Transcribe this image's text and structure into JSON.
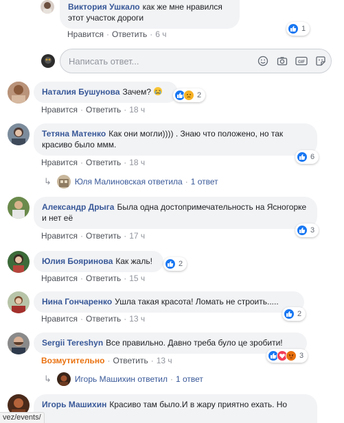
{
  "comments": [
    {
      "author": "Виктория Ушкало",
      "text": "как же мне нравился этот участок дороги",
      "like_label": "Нравится",
      "reply_label": "Ответить",
      "time": "6 ч",
      "reaction_count": "1"
    },
    {
      "author": "Наталия Бушунова",
      "text": "Зачем?",
      "like_label": "Нравится",
      "reply_label": "Ответить",
      "time": "18 ч",
      "reaction_count": "2"
    },
    {
      "author": "Тетяна Матенко",
      "text": "Как они могли)))) . Знаю что положено, но так красиво было ммм.",
      "like_label": "Нравится",
      "reply_label": "Ответить",
      "time": "18 ч",
      "reaction_count": "6"
    },
    {
      "author": "Александр Дрыга",
      "text": "Была одна достопримечательность на Ясногорке и нет её",
      "like_label": "Нравится",
      "reply_label": "Ответить",
      "time": "17 ч",
      "reaction_count": "3"
    },
    {
      "author": "Юлия Бояринова",
      "text": "Как жаль!",
      "like_label": "Нравится",
      "reply_label": "Ответить",
      "time": "15 ч",
      "reaction_count": "2"
    },
    {
      "author": "Нина Гончаренко",
      "text": "Ушла такая красота! Ломать не строить.....",
      "like_label": "Нравится",
      "reply_label": "Ответить",
      "time": "13 ч",
      "reaction_count": "2"
    },
    {
      "author": "Sergii Tereshyn",
      "text": "Все правильно. Давно треба було це зробити!",
      "like_label": "Возмутительно",
      "reply_label": "Ответить",
      "time": "13 ч",
      "reaction_count": "3"
    },
    {
      "author": "Игорь Машихин",
      "text": "Красиво там было.И в жару приятно ехать. Но"
    }
  ],
  "replies": [
    {
      "text": "Юля Малиновская ответила",
      "count": "1 ответ"
    },
    {
      "text": "Игорь Машихин ответил",
      "count": "1 ответ"
    }
  ],
  "composer": {
    "placeholder": "Написать ответ..."
  },
  "status_bar": {
    "url": "vez/events/"
  },
  "colors": {
    "link": "#385898",
    "like_blue": "#1877f2",
    "love": "#f33e58",
    "angry": "#e9710f",
    "bubble": "#f2f3f5"
  }
}
